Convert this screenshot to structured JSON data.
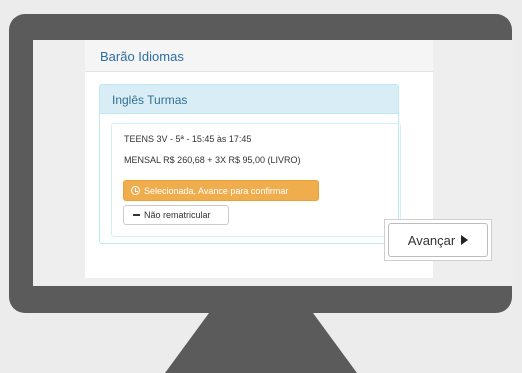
{
  "site": {
    "title": "Barão Idiomas"
  },
  "panel": {
    "title": "Inglês Turmas"
  },
  "class_option": {
    "schedule": "TEENS 3V - 5ª - 15:45 às 17:45",
    "price": "MENSAL R$ 260,68 + 3X R$ 95,00 (LIVRO)",
    "selected_label": "Selecionada, Avance para confirmar",
    "decline_label": "Não rematricular"
  },
  "navigation": {
    "next_label": "Avançar"
  },
  "icons": {
    "selected": "clock-icon",
    "decline": "minus-icon",
    "next": "caret-right-icon"
  },
  "colors": {
    "monitor_frame": "#5b5b5b",
    "background": "#ececec",
    "link_blue": "#2e6da4",
    "panel_header": "#d9edf7",
    "warning_button": "#f0ad4e"
  }
}
